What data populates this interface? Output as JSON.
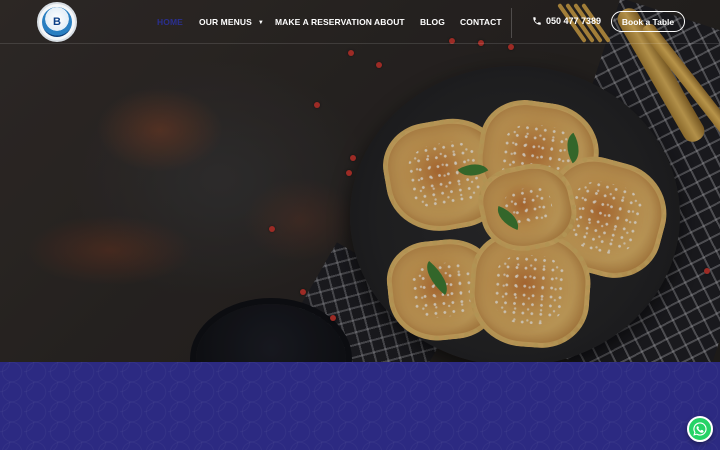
{
  "nav": {
    "logo_alt": "Blue Dragon",
    "logo_mark": "B",
    "items": [
      {
        "label": "HOME",
        "active": true
      },
      {
        "label": "OUR MENUS",
        "dropdown": true
      },
      {
        "label": "MAKE A RESERVATION"
      },
      {
        "label": "ABOUT"
      },
      {
        "label": "BLOG"
      },
      {
        "label": "CONTACT"
      }
    ],
    "phone": "050 477 7389",
    "book_button": "Book a Table"
  },
  "colors": {
    "accent_active": "#2a2f8f",
    "band": "#2c2a82",
    "whatsapp": "#25d366"
  },
  "icons": {
    "phone": "phone-icon",
    "whatsapp": "whatsapp-icon",
    "dropdown": "chevron-down-icon"
  }
}
